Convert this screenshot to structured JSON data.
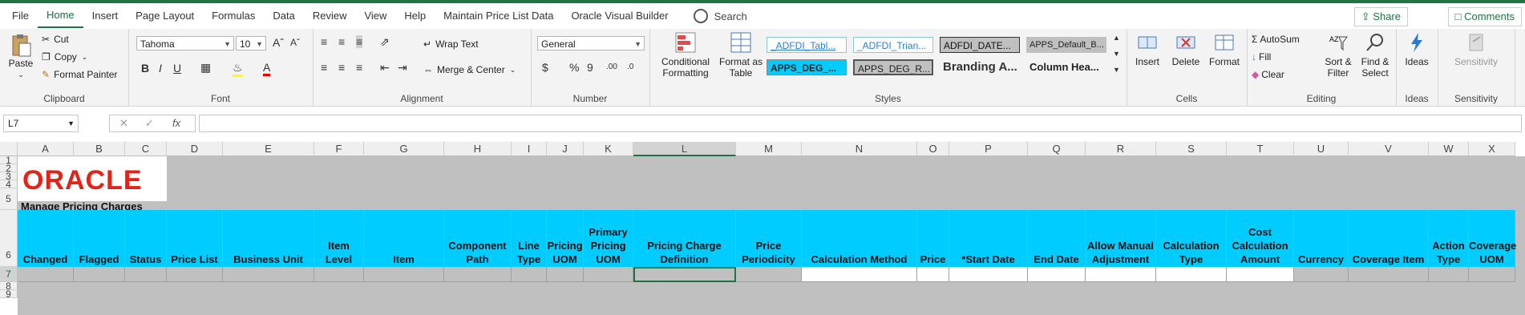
{
  "menu": {
    "tabs": [
      "File",
      "Home",
      "Insert",
      "Page Layout",
      "Formulas",
      "Data",
      "Review",
      "View",
      "Help",
      "Maintain Price List Data",
      "Oracle Visual Builder"
    ],
    "search": "Search",
    "share": "Share",
    "comments": "Comments"
  },
  "ribbon": {
    "clipboard": {
      "label": "Clipboard",
      "paste": "Paste",
      "cut": "Cut",
      "copy": "Copy",
      "format_painter": "Format Painter"
    },
    "font": {
      "label": "Font",
      "name": "Tahoma",
      "size": "10"
    },
    "alignment": {
      "label": "Alignment",
      "wrap": "Wrap Text",
      "merge": "Merge & Center"
    },
    "number": {
      "label": "Number",
      "format": "General"
    },
    "styles": {
      "label": "Styles",
      "conditional": "Conditional Formatting",
      "format_table": "Format as Table",
      "style1": "_ADFDI_Tabl...",
      "style2": "_ADFDI_Trian...",
      "style3": "ADFDI_DATE...",
      "style4": "APPS_Default_B...",
      "style5": "APPS_DEG_...",
      "style6": "APPS_DEG_R...",
      "style7": "Branding A...",
      "style8": "Column Hea..."
    },
    "cells": {
      "label": "Cells",
      "insert": "Insert",
      "delete": "Delete",
      "format": "Format"
    },
    "editing": {
      "label": "Editing",
      "autosum": "AutoSum",
      "fill": "Fill",
      "clear": "Clear",
      "sort": "Sort & Filter",
      "find": "Find & Select"
    },
    "ideas": {
      "label": "Ideas",
      "btn": "Ideas"
    },
    "sensitivity": {
      "label": "Sensitivity",
      "btn": "Sensitivity"
    }
  },
  "formula": {
    "namebox": "L7",
    "fx": "fx",
    "value": ""
  },
  "sheet": {
    "columns": [
      "A",
      "B",
      "C",
      "D",
      "E",
      "F",
      "G",
      "H",
      "I",
      "J",
      "K",
      "L",
      "M",
      "N",
      "O",
      "P",
      "Q",
      "R",
      "S",
      "T",
      "U",
      "V",
      "W",
      "X"
    ],
    "selected_column": "L",
    "rows": [
      "1",
      "2",
      "3",
      "4",
      "5",
      "6",
      "7",
      "8",
      "9"
    ],
    "logo_text": "ORACLE",
    "title": "Manage Pricing Charges",
    "headers": [
      "Changed",
      "Flagged",
      "Status",
      "Price List",
      "Business Unit",
      "Item Level",
      "Item",
      "Component Path",
      "Line Type",
      "Pricing UOM",
      "Primary Pricing UOM",
      "Pricing Charge Definition",
      "Price Periodicity",
      "Calculation Method",
      "Price",
      "*Start Date",
      "End Date",
      "Allow Manual Adjustment",
      "Calculation Type",
      "Cost Calculation Amount",
      "Currency",
      "Coverage Item",
      "Action Type",
      "Coverage UOM"
    ],
    "colors": {
      "header_band": "#00ccff",
      "sheet_bg": "#c0c0c0",
      "accent": "#217346",
      "logo_red": "#e2231a"
    }
  }
}
